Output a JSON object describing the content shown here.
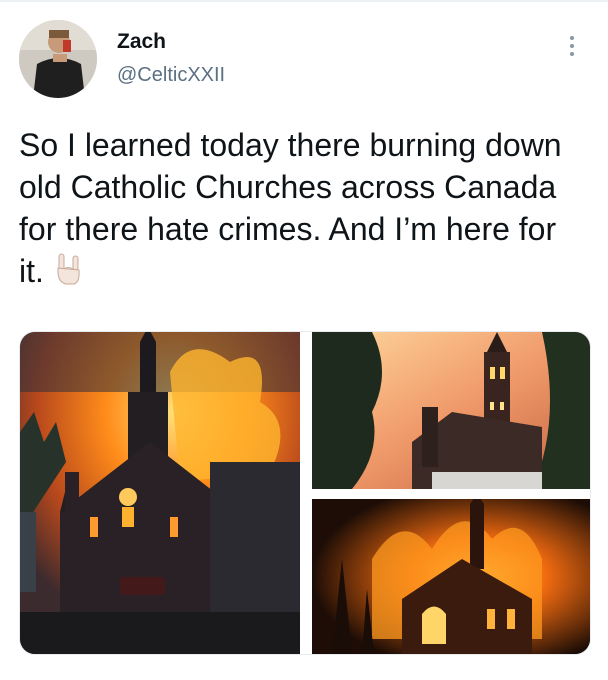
{
  "tweet": {
    "author_name": "Zach",
    "author_handle": "@CelticXXII",
    "text": "So I learned today there burning down old Catholic Churches across Canada for there hate crimes. And I’m here for it.",
    "emoji_icon": "sign-of-the-horns-emoji"
  },
  "icons": {
    "more": "more-options-icon"
  },
  "media": {
    "count": 3
  }
}
